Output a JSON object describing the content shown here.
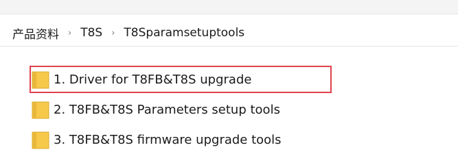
{
  "breadcrumb": {
    "items": [
      {
        "label": "产品资料"
      },
      {
        "label": "T8S"
      },
      {
        "label": "T8Sparamsetuptools"
      }
    ],
    "separator": "›"
  },
  "files": [
    {
      "name": "1. Driver for T8FB&T8S upgrade",
      "icon": "folder-icon",
      "selected": true
    },
    {
      "name": "2. T8FB&T8S Parameters setup tools",
      "icon": "folder-icon",
      "selected": false
    },
    {
      "name": "3. T8FB&T8S firmware upgrade tools",
      "icon": "folder-icon",
      "selected": false
    }
  ],
  "colors": {
    "folder": "#f6c94b",
    "selection_border": "#e0404c"
  }
}
